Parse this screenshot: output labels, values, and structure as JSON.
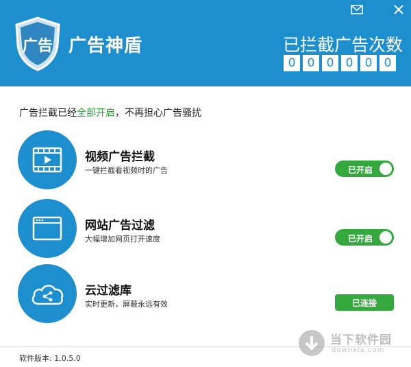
{
  "header": {
    "app_title": "广告神盾",
    "logo_text": "广告",
    "count_title": "已拦截广告次数",
    "counter_digits": [
      "0",
      "0",
      "0",
      "0",
      "0",
      "0"
    ]
  },
  "status": {
    "prefix": "广告拦截已经",
    "highlight": "全部开启",
    "suffix": "，不再担心广告骚扰"
  },
  "features": [
    {
      "title": "视频广告拦截",
      "description": "一键拦截看视频时的广告",
      "toggle_label": "已开启",
      "icon": "video-play-icon"
    },
    {
      "title": "网站广告过滤",
      "description": "大幅增加网页打开速度",
      "toggle_label": "已开启",
      "icon": "browser-window-icon"
    },
    {
      "title": "云过滤库",
      "description": "实时更新，屏蔽永远有效",
      "button_label": "已连接",
      "icon": "cloud-share-icon"
    }
  ],
  "footer": {
    "version": "软件版本: 1.0.5.0"
  },
  "watermark": {
    "name": "当下软件园",
    "domain": "downxia.com"
  },
  "colors": {
    "primary": "#1e8fce",
    "accent_green": "#34a83c",
    "highlight_text": "#2fa33a"
  }
}
